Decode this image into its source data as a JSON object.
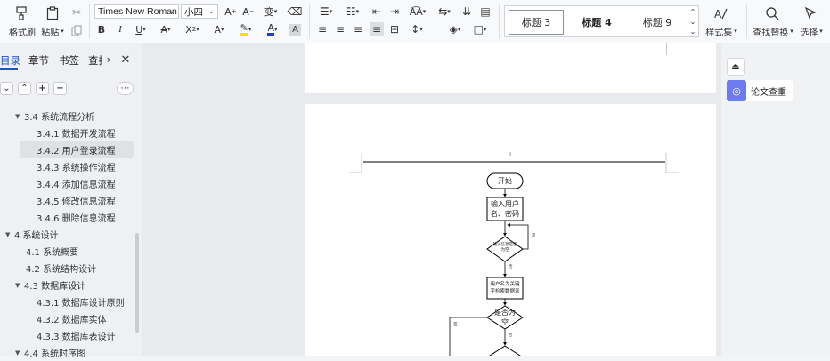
{
  "ribbon": {
    "format_painter": "格式刷",
    "paste": "粘贴",
    "font_name": "Times New Roman",
    "font_size": "小四",
    "style_heading3": "标题 3",
    "style_heading4": "标题 4",
    "style_heading9": "标题 9",
    "style_set": "样式集",
    "find_replace": "查找替换",
    "select": "选择"
  },
  "sidebar": {
    "tabs": [
      "目录",
      "章节",
      "书签",
      "查找"
    ],
    "toc": [
      {
        "label": "3.4  系统流程分析",
        "level": 1,
        "arrow": "▼"
      },
      {
        "label": "3.4.1  数据开发流程",
        "level": 2
      },
      {
        "label": "3.4.2  用户登录流程",
        "level": 2,
        "selected": true
      },
      {
        "label": "3.4.3  系统操作流程",
        "level": 2
      },
      {
        "label": "3.4.4  添加信息流程",
        "level": 2
      },
      {
        "label": "3.4.5  修改信息流程",
        "level": 2
      },
      {
        "label": "3.4.6  删除信息流程",
        "level": 2
      },
      {
        "label": "4  系统设计",
        "level": 0,
        "arrow": "▼"
      },
      {
        "label": "4.1  系统概要",
        "level": 1
      },
      {
        "label": "4.2  系统结构设计",
        "level": 1
      },
      {
        "label": "4.3  数据库设计",
        "level": 1,
        "arrow": "▼"
      },
      {
        "label": "4.3.1  数据库设计原则",
        "level": 2
      },
      {
        "label": "4.3.2  数据库实体",
        "level": 2
      },
      {
        "label": "4.3.3  数据库表设计",
        "level": 2
      },
      {
        "label": "4.4  系统时序图",
        "level": 1,
        "arrow": "▼"
      }
    ]
  },
  "document": {
    "page_number": "9",
    "flowchart": {
      "start": "开始",
      "input_line1": "输入用户",
      "input_line2": "名、密码",
      "check_line1": "输入信息是否",
      "check_line2": "为空",
      "yes": "是",
      "no": "否",
      "query_line1": "用户名为关键",
      "query_line2": "字检索数据表",
      "empty_line1": "是否为",
      "empty_line2": "空",
      "no2": "否",
      "yes2": "是"
    }
  },
  "right_panel": {
    "paper_check": "论文查重"
  }
}
